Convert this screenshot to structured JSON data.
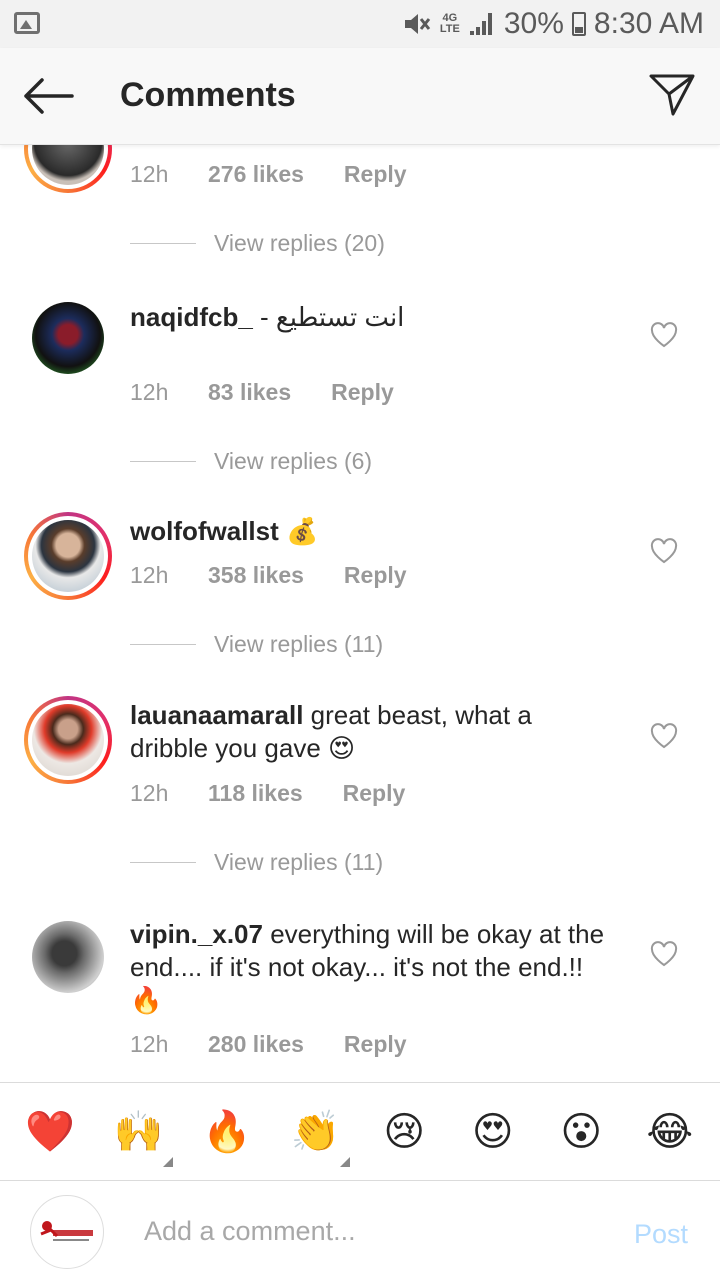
{
  "status": {
    "signal_type": "4G LTE",
    "battery": "30%",
    "time": "8:30 AM"
  },
  "header": {
    "title": "Comments"
  },
  "comments": [
    {
      "username": "",
      "text": "",
      "time": "12h",
      "likes": "276 likes",
      "reply": "Reply",
      "view_replies": "View replies (20)"
    },
    {
      "username": "naqidfcb_",
      "text": " - انت تستطيع",
      "time": "12h",
      "likes": "83 likes",
      "reply": "Reply",
      "view_replies": "View replies (6)"
    },
    {
      "username": "wolfofwallst",
      "text": " 💰",
      "time": "12h",
      "likes": "358 likes",
      "reply": "Reply",
      "view_replies": "View replies (11)"
    },
    {
      "username": "lauanaamarall",
      "text": " great beast, what a dribble you gave 😍",
      "time": "12h",
      "likes": "118 likes",
      "reply": "Reply",
      "view_replies": "View replies (11)"
    },
    {
      "username": "vipin._x.07",
      "text": " everything will be okay at the end.... if it's not okay... it's not the end.!!🔥",
      "time": "12h",
      "likes": "280 likes",
      "reply": "Reply"
    }
  ],
  "emoji_bar": [
    "❤️",
    "🙌",
    "🔥",
    "👏",
    "😢",
    "😍",
    "😮",
    "😂"
  ],
  "composer": {
    "placeholder": "Add a comment...",
    "post_label": "Post"
  },
  "colors": {
    "story_ring": "#e1306c",
    "post_disabled": "#b3dbff",
    "meta_gray": "#999999"
  }
}
